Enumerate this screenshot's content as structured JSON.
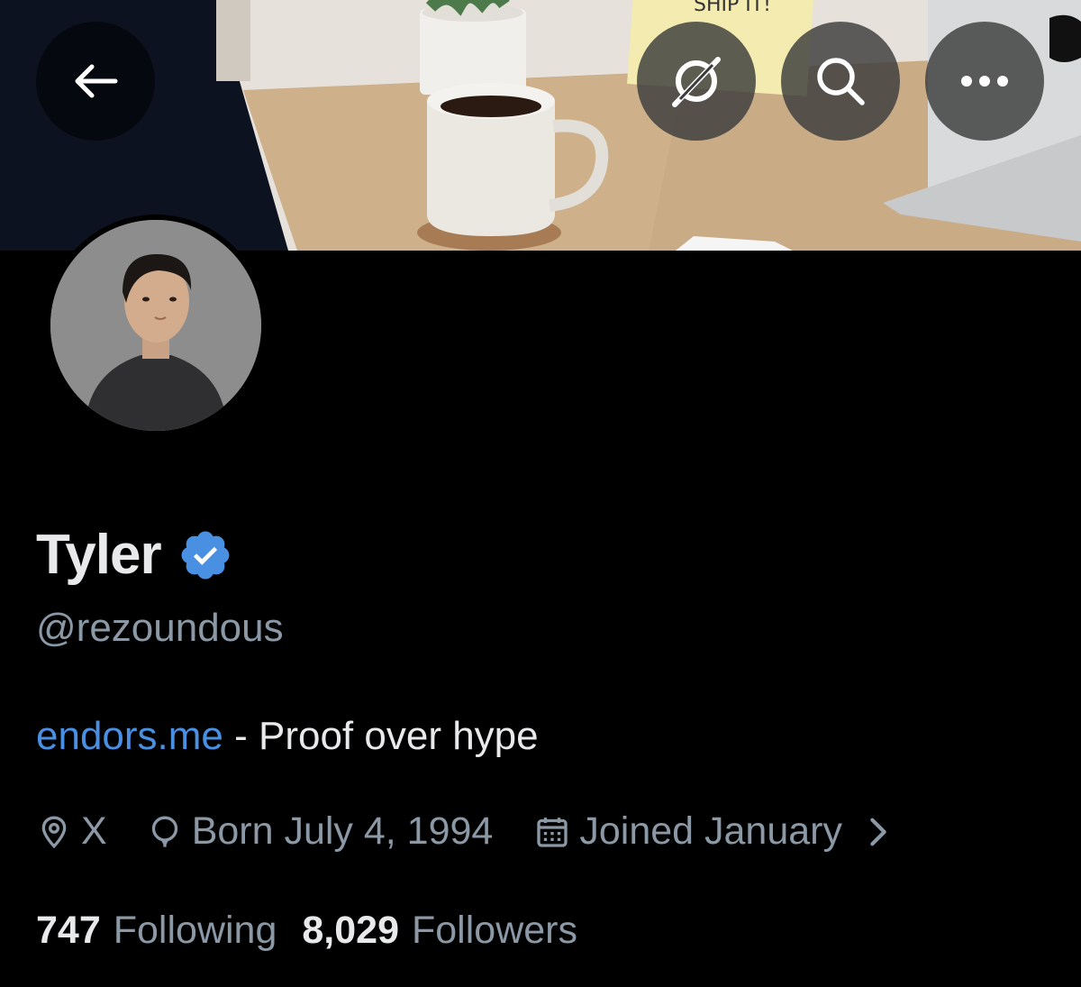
{
  "header": {
    "back_icon": "arrow-left-icon",
    "grok_icon": "grok-icon",
    "search_icon": "search-icon",
    "more_icon": "more-horizontal-icon",
    "banner_note_text": "SHIP IT!"
  },
  "profile": {
    "display_name": "Tyler",
    "verified": true,
    "verified_color": "#4a90e2",
    "handle": "@rezoundous",
    "bio": {
      "link_text": "endors.me",
      "text": " - Proof over hype"
    },
    "meta": {
      "location_icon": "location-pin-icon",
      "location": "X",
      "birthday_icon": "balloon-icon",
      "birthday": "Born July 4, 1994",
      "joined_icon": "calendar-icon",
      "joined": "Joined January"
    },
    "stats": {
      "following_count": "747",
      "following_label": "Following",
      "followers_count": "8,029",
      "followers_label": "Followers"
    }
  },
  "colors": {
    "background": "#000000",
    "primary_text": "#e7e9ea",
    "secondary_text": "#8b98a5",
    "link": "#4a90e2"
  }
}
